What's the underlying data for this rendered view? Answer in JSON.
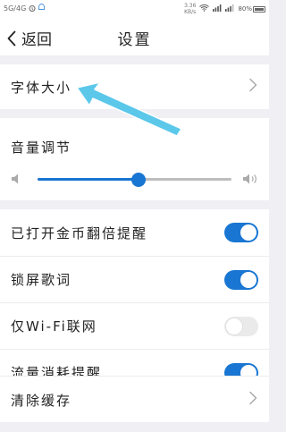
{
  "status_bar": {
    "carrier": "5G/4G",
    "time_top": "3.36",
    "time_bottom": "KB/s",
    "battery_label": "80%"
  },
  "nav": {
    "back_label": "返回",
    "title": "设置"
  },
  "font_size": {
    "label": "字体大小"
  },
  "volume": {
    "label": "音量调节",
    "level": 0.52
  },
  "toggles": [
    {
      "label": "已打开金币翻倍提醒",
      "on": true
    },
    {
      "label": "锁屏歌词",
      "on": true
    },
    {
      "label": "仅Wi-Fi联网",
      "on": false
    },
    {
      "label": "流量消耗提醒",
      "on": true
    }
  ],
  "clear_cache": {
    "label": "清除缓存"
  },
  "colors": {
    "accent": "#1976d2",
    "annotation_arrow": "#5bc8ea"
  }
}
